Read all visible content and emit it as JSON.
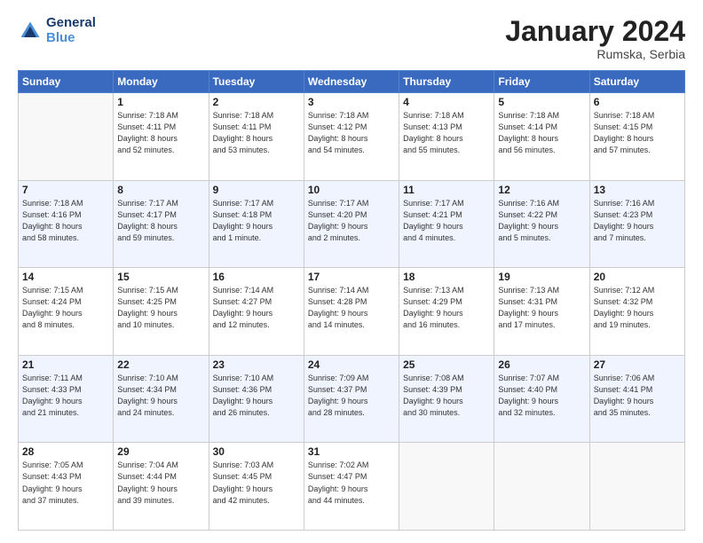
{
  "header": {
    "logo_line1": "General",
    "logo_line2": "Blue",
    "month": "January 2024",
    "location": "Rumska, Serbia"
  },
  "weekdays": [
    "Sunday",
    "Monday",
    "Tuesday",
    "Wednesday",
    "Thursday",
    "Friday",
    "Saturday"
  ],
  "weeks": [
    [
      {
        "day": "",
        "info": ""
      },
      {
        "day": "1",
        "info": "Sunrise: 7:18 AM\nSunset: 4:11 PM\nDaylight: 8 hours\nand 52 minutes."
      },
      {
        "day": "2",
        "info": "Sunrise: 7:18 AM\nSunset: 4:11 PM\nDaylight: 8 hours\nand 53 minutes."
      },
      {
        "day": "3",
        "info": "Sunrise: 7:18 AM\nSunset: 4:12 PM\nDaylight: 8 hours\nand 54 minutes."
      },
      {
        "day": "4",
        "info": "Sunrise: 7:18 AM\nSunset: 4:13 PM\nDaylight: 8 hours\nand 55 minutes."
      },
      {
        "day": "5",
        "info": "Sunrise: 7:18 AM\nSunset: 4:14 PM\nDaylight: 8 hours\nand 56 minutes."
      },
      {
        "day": "6",
        "info": "Sunrise: 7:18 AM\nSunset: 4:15 PM\nDaylight: 8 hours\nand 57 minutes."
      }
    ],
    [
      {
        "day": "7",
        "info": "Sunrise: 7:18 AM\nSunset: 4:16 PM\nDaylight: 8 hours\nand 58 minutes."
      },
      {
        "day": "8",
        "info": "Sunrise: 7:17 AM\nSunset: 4:17 PM\nDaylight: 8 hours\nand 59 minutes."
      },
      {
        "day": "9",
        "info": "Sunrise: 7:17 AM\nSunset: 4:18 PM\nDaylight: 9 hours\nand 1 minute."
      },
      {
        "day": "10",
        "info": "Sunrise: 7:17 AM\nSunset: 4:20 PM\nDaylight: 9 hours\nand 2 minutes."
      },
      {
        "day": "11",
        "info": "Sunrise: 7:17 AM\nSunset: 4:21 PM\nDaylight: 9 hours\nand 4 minutes."
      },
      {
        "day": "12",
        "info": "Sunrise: 7:16 AM\nSunset: 4:22 PM\nDaylight: 9 hours\nand 5 minutes."
      },
      {
        "day": "13",
        "info": "Sunrise: 7:16 AM\nSunset: 4:23 PM\nDaylight: 9 hours\nand 7 minutes."
      }
    ],
    [
      {
        "day": "14",
        "info": "Sunrise: 7:15 AM\nSunset: 4:24 PM\nDaylight: 9 hours\nand 8 minutes."
      },
      {
        "day": "15",
        "info": "Sunrise: 7:15 AM\nSunset: 4:25 PM\nDaylight: 9 hours\nand 10 minutes."
      },
      {
        "day": "16",
        "info": "Sunrise: 7:14 AM\nSunset: 4:27 PM\nDaylight: 9 hours\nand 12 minutes."
      },
      {
        "day": "17",
        "info": "Sunrise: 7:14 AM\nSunset: 4:28 PM\nDaylight: 9 hours\nand 14 minutes."
      },
      {
        "day": "18",
        "info": "Sunrise: 7:13 AM\nSunset: 4:29 PM\nDaylight: 9 hours\nand 16 minutes."
      },
      {
        "day": "19",
        "info": "Sunrise: 7:13 AM\nSunset: 4:31 PM\nDaylight: 9 hours\nand 17 minutes."
      },
      {
        "day": "20",
        "info": "Sunrise: 7:12 AM\nSunset: 4:32 PM\nDaylight: 9 hours\nand 19 minutes."
      }
    ],
    [
      {
        "day": "21",
        "info": "Sunrise: 7:11 AM\nSunset: 4:33 PM\nDaylight: 9 hours\nand 21 minutes."
      },
      {
        "day": "22",
        "info": "Sunrise: 7:10 AM\nSunset: 4:34 PM\nDaylight: 9 hours\nand 24 minutes."
      },
      {
        "day": "23",
        "info": "Sunrise: 7:10 AM\nSunset: 4:36 PM\nDaylight: 9 hours\nand 26 minutes."
      },
      {
        "day": "24",
        "info": "Sunrise: 7:09 AM\nSunset: 4:37 PM\nDaylight: 9 hours\nand 28 minutes."
      },
      {
        "day": "25",
        "info": "Sunrise: 7:08 AM\nSunset: 4:39 PM\nDaylight: 9 hours\nand 30 minutes."
      },
      {
        "day": "26",
        "info": "Sunrise: 7:07 AM\nSunset: 4:40 PM\nDaylight: 9 hours\nand 32 minutes."
      },
      {
        "day": "27",
        "info": "Sunrise: 7:06 AM\nSunset: 4:41 PM\nDaylight: 9 hours\nand 35 minutes."
      }
    ],
    [
      {
        "day": "28",
        "info": "Sunrise: 7:05 AM\nSunset: 4:43 PM\nDaylight: 9 hours\nand 37 minutes."
      },
      {
        "day": "29",
        "info": "Sunrise: 7:04 AM\nSunset: 4:44 PM\nDaylight: 9 hours\nand 39 minutes."
      },
      {
        "day": "30",
        "info": "Sunrise: 7:03 AM\nSunset: 4:45 PM\nDaylight: 9 hours\nand 42 minutes."
      },
      {
        "day": "31",
        "info": "Sunrise: 7:02 AM\nSunset: 4:47 PM\nDaylight: 9 hours\nand 44 minutes."
      },
      {
        "day": "",
        "info": ""
      },
      {
        "day": "",
        "info": ""
      },
      {
        "day": "",
        "info": ""
      }
    ]
  ]
}
